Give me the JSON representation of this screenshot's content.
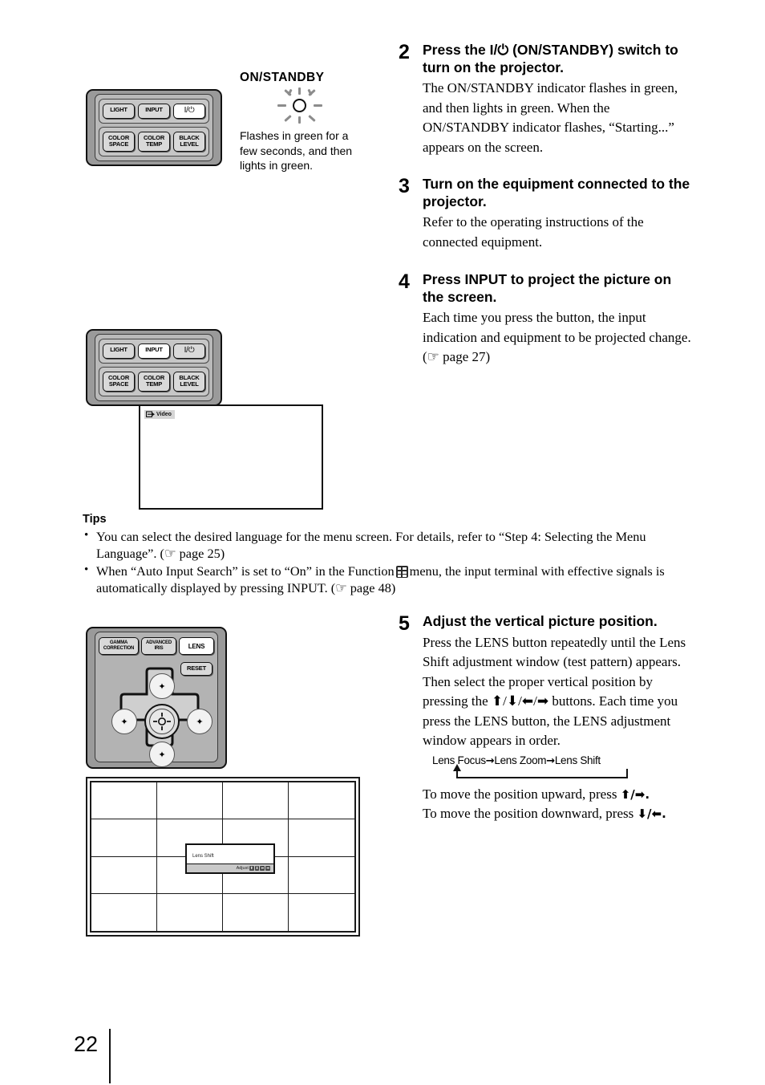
{
  "page": {
    "number": "22"
  },
  "figure_top": {
    "indicator_label": "ON/STANDBY",
    "indicator_icon": "flashing-lamp-icon",
    "caption": "Flashes in green for a few seconds, and then lights in green."
  },
  "remote_top": {
    "name": "remote-control-power",
    "row1": [
      {
        "label": "LIGHT",
        "highlighted": false
      },
      {
        "label": "INPUT",
        "highlighted": false
      },
      {
        "label": "I/⏻",
        "highlighted": true
      }
    ],
    "row2": [
      {
        "label": "COLOR SPACE",
        "highlighted": false
      },
      {
        "label": "COLOR TEMP",
        "highlighted": false
      },
      {
        "label": "BLACK LEVEL",
        "highlighted": false
      }
    ]
  },
  "remote_input": {
    "name": "remote-control-input",
    "row1": [
      {
        "label": "LIGHT",
        "highlighted": false
      },
      {
        "label": "INPUT",
        "highlighted": true
      },
      {
        "label": "I/⏻",
        "highlighted": false
      }
    ],
    "row2": [
      {
        "label": "COLOR SPACE",
        "highlighted": false
      },
      {
        "label": "COLOR TEMP",
        "highlighted": false
      },
      {
        "label": "BLACK LEVEL",
        "highlighted": false
      }
    ]
  },
  "projected_screen": {
    "input_badge": "Video",
    "input_badge_icon": "input-source-icon"
  },
  "remote_lens": {
    "name": "remote-control-lens",
    "top_buttons": [
      {
        "label": "GAMMA CORRECTION",
        "highlighted": false
      },
      {
        "label": "ADVANCED IRIS",
        "highlighted": false
      },
      {
        "label": "LENS",
        "highlighted": true
      }
    ],
    "reset_button": "RESET",
    "dpad": {
      "up": "✦",
      "down": "✦",
      "left": "✦",
      "right": "✦",
      "center": "enter-button"
    }
  },
  "tips": {
    "heading": "Tips",
    "items": [
      "You can select the desired language for the menu screen. For details, refer to “Step 4: Selecting the Menu Language”. (☞ page 25)",
      "When “Auto Input Search” is set to “On” in the Function � menu, the input terminal with effective signals is automatically displayed by pressing INPUT. (☞ page 48)"
    ],
    "item2_part1": "When “Auto Input Search” is set to “On” in the Function",
    "item2_part2": "menu, the input terminal with effective signals is automatically displayed by pressing INPUT. (☞ page 48)",
    "function_menu_icon": "function-menu-icon"
  },
  "steps": [
    {
      "number": "2",
      "title": "Press the I/⏻ (ON/STANDBY) switch to turn on the projector.",
      "text": "The ON/STANDBY indicator flashes in green, and then lights in green. When the ON/STANDBY indicator flashes, “Starting...” appears on the screen."
    },
    {
      "number": "3",
      "title": "Turn on the equipment connected to the projector.",
      "text": "Refer to the operating instructions of the connected equipment."
    },
    {
      "number": "4",
      "title": "Press INPUT to project the picture on the screen.",
      "text": "Each time you press the button, the input indication and equipment to be projected change. (☞ page 27)"
    },
    {
      "number": "5",
      "title": "Adjust the vertical picture position.",
      "text": "Press the LENS button repeatedly until the Lens Shift adjustment window (test pattern) appears. Then select the proper vertical position by pressing the ⬆/⬇/⬅/➡ buttons. Each time you press the LENS button, the LENS adjustment window appears in order."
    }
  ],
  "lens_flow": {
    "items": [
      "Lens Focus",
      "Lens Zoom",
      "Lens Shift"
    ],
    "arrow": "→"
  },
  "lens_move": {
    "upward": "To move the position upward, press ⬆/➡.",
    "upward_prefix": "To move the position upward, press",
    "upward_keys": "⬆/➡.",
    "downward_prefix": "To move the position downward, press",
    "downward_keys": "⬇/⬅."
  },
  "test_pattern": {
    "dialog_title": "Lens Shift",
    "dialog_action": "Adjust",
    "dialog_keys": [
      "⬆",
      "⬇",
      "⬅",
      "➡"
    ],
    "columns": 4,
    "rows": 4
  }
}
